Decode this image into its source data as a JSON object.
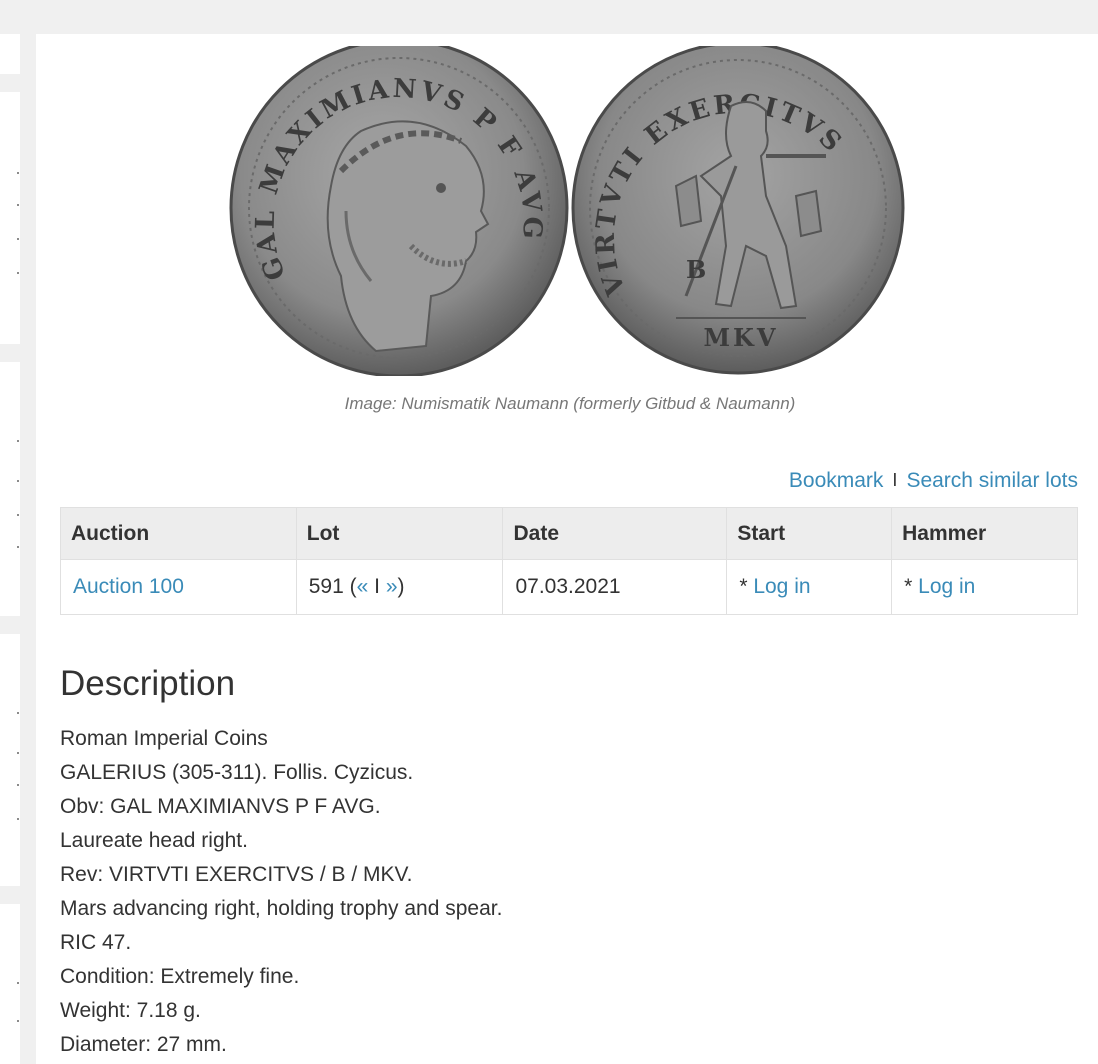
{
  "image": {
    "caption": "Image: Numismatik Naumann (formerly Gitbud & Naumann)",
    "obverse_legend": "GAL MAXIMIANVS P F AVG",
    "reverse_legend": "VIRTVTI EXERCITVS",
    "reverse_field": "B",
    "reverse_exergue": "MKV"
  },
  "actions": {
    "bookmark": "Bookmark",
    "separator": "I",
    "search_similar": "Search similar lots"
  },
  "table": {
    "headers": [
      "Auction",
      "Lot",
      "Date",
      "Start",
      "Hammer"
    ],
    "row": {
      "auction": "Auction 100",
      "lot_number": "591 (",
      "lot_prev": "«",
      "lot_sep": " I ",
      "lot_next": "»",
      "lot_close": ")",
      "date": "07.03.2021",
      "start_prefix": "* ",
      "start_link": "Log in",
      "hammer_prefix": "* ",
      "hammer_link": "Log in"
    }
  },
  "description": {
    "title": "Description",
    "lines": [
      "Roman Imperial Coins",
      "GALERIUS (305-311). Follis. Cyzicus.",
      "Obv: GAL MAXIMIANVS P F AVG.",
      "Laureate head right.",
      "Rev: VIRTVTI EXERCITVS / B / MKV.",
      "Mars advancing right, holding trophy and spear.",
      "RIC 47.",
      "Condition: Extremely fine.",
      "Weight: 7.18 g.",
      "Diameter: 27 mm."
    ]
  },
  "colors": {
    "link": "#3a8bb8",
    "header_bg": "#ededed",
    "page_bg": "#f0f0f0"
  }
}
